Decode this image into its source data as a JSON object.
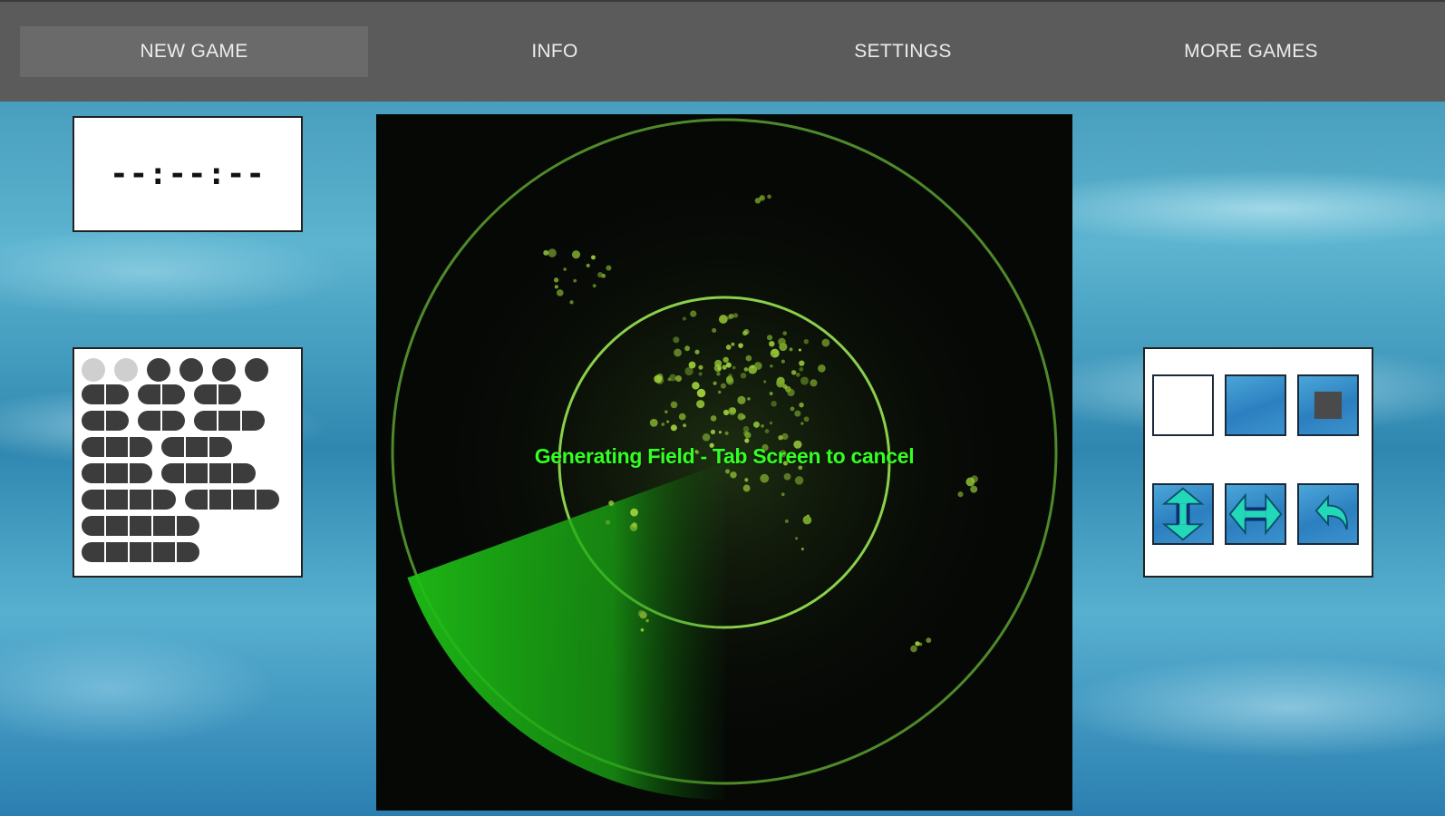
{
  "menu": {
    "items": [
      {
        "label": "NEW GAME",
        "active": true
      },
      {
        "label": "INFO",
        "active": false
      },
      {
        "label": "SETTINGS",
        "active": false
      },
      {
        "label": "MORE GAMES",
        "active": false
      }
    ]
  },
  "timer": {
    "display": "--:--:--"
  },
  "fleet": {
    "ships": [
      {
        "size": 1,
        "count": 6,
        "placed_light": 2
      },
      {
        "size": 2,
        "count": 3
      },
      {
        "size": 2,
        "count": 2,
        "extra": 1
      },
      {
        "size": 3,
        "count": 2
      },
      {
        "size": 3,
        "count": 1,
        "extra": 1
      },
      {
        "size": 4,
        "count": 1,
        "extra": 1
      },
      {
        "size": 4,
        "count": 1
      },
      {
        "size": 4,
        "count": 1
      }
    ]
  },
  "radar": {
    "message": "Generating Field - Tab Screen to cancel",
    "colors": {
      "ring": "#6db33a",
      "sweep": "#22d41a",
      "text": "#33ff22"
    }
  },
  "tools": {
    "buttons": [
      {
        "icon": "empty-cell-icon",
        "style": "white"
      },
      {
        "icon": "water-cell-icon",
        "style": "blue"
      },
      {
        "icon": "ship-cell-icon",
        "style": "blue"
      },
      {
        "icon": "vertical-arrow-icon",
        "style": "blue"
      },
      {
        "icon": "horizontal-arrow-icon",
        "style": "blue"
      },
      {
        "icon": "undo-icon",
        "style": "blue"
      }
    ]
  }
}
